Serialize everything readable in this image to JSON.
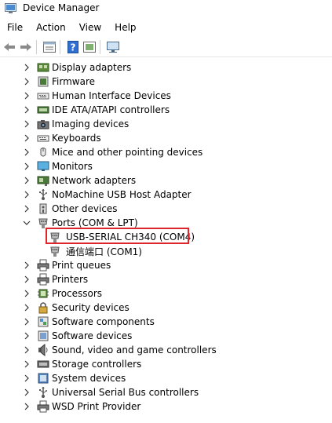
{
  "window": {
    "title": "Device Manager"
  },
  "menu": {
    "items": [
      "File",
      "Action",
      "View",
      "Help"
    ]
  },
  "tree": {
    "categories": [
      {
        "label": "Display adapters",
        "icon": "display-adapter-icon"
      },
      {
        "label": "Firmware",
        "icon": "firmware-icon"
      },
      {
        "label": "Human Interface Devices",
        "icon": "hid-icon"
      },
      {
        "label": "IDE ATA/ATAPI controllers",
        "icon": "ide-controller-icon"
      },
      {
        "label": "Imaging devices",
        "icon": "camera-icon"
      },
      {
        "label": "Keyboards",
        "icon": "keyboard-icon"
      },
      {
        "label": "Mice and other pointing devices",
        "icon": "mouse-icon"
      },
      {
        "label": "Monitors",
        "icon": "monitor-icon"
      },
      {
        "label": "Network adapters",
        "icon": "network-adapter-icon"
      },
      {
        "label": "NoMachine USB Host Adapter",
        "icon": "usb-icon"
      },
      {
        "label": "Other devices",
        "icon": "unknown-device-icon"
      },
      {
        "label": "Ports (COM & LPT)",
        "icon": "port-icon",
        "expanded": true
      },
      {
        "label": "Print queues",
        "icon": "printer-icon"
      },
      {
        "label": "Printers",
        "icon": "printer-icon"
      },
      {
        "label": "Processors",
        "icon": "processor-icon"
      },
      {
        "label": "Security devices",
        "icon": "security-device-icon"
      },
      {
        "label": "Software components",
        "icon": "software-component-icon"
      },
      {
        "label": "Software devices",
        "icon": "software-device-icon"
      },
      {
        "label": "Sound, video and game controllers",
        "icon": "speaker-icon"
      },
      {
        "label": "Storage controllers",
        "icon": "storage-controller-icon"
      },
      {
        "label": "System devices",
        "icon": "system-device-icon"
      },
      {
        "label": "Universal Serial Bus controllers",
        "icon": "usb-icon"
      },
      {
        "label": "WSD Print Provider",
        "icon": "printer-icon"
      }
    ],
    "ports_children": [
      {
        "label": "USB-SERIAL CH340 (COM4)",
        "icon": "port-icon",
        "highlighted": true
      },
      {
        "label": "通信端口 (COM1)",
        "icon": "port-icon"
      }
    ]
  },
  "colors": {
    "highlight_border": "#e0242c"
  }
}
